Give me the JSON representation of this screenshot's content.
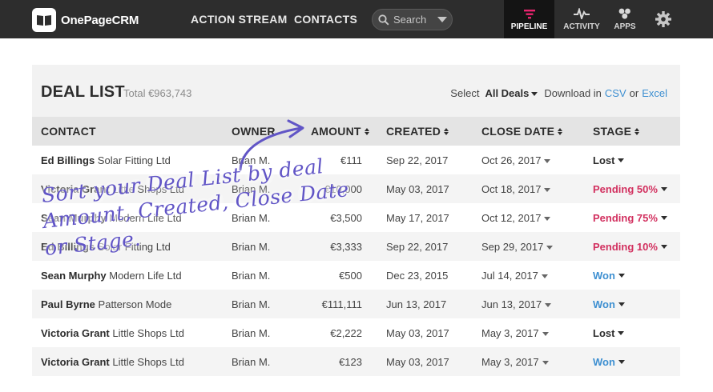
{
  "brand": {
    "name": "OnePageCRM"
  },
  "nav": {
    "links": [
      "ACTION STREAM",
      "CONTACTS"
    ],
    "search_placeholder": "Search",
    "icon_tabs": [
      {
        "label": "PIPELINE",
        "icon": "funnel-icon",
        "active": true
      },
      {
        "label": "ACTIVITY",
        "icon": "pulse-icon",
        "active": false
      },
      {
        "label": "APPS",
        "icon": "apps-icon",
        "active": false
      }
    ],
    "settings_icon": "gear-icon"
  },
  "deal_list": {
    "title": "DEAL LIST",
    "total": "Total €963,743",
    "select_label": "Select",
    "select_value": "All Deals",
    "download_label": "Download in",
    "csv_label": "CSV",
    "or_label": "or",
    "excel_label": "Excel",
    "columns": [
      "CONTACT",
      "OWNER",
      "AMOUNT",
      "CREATED",
      "CLOSE DATE",
      "STAGE"
    ],
    "rows": [
      {
        "name": "Ed Billings",
        "company": "Solar Fitting Ltd",
        "owner": "Brian M.",
        "amount": "€111",
        "created": "Sep 22, 2017",
        "close": "Oct 26, 2017",
        "stage": "Lost",
        "stage_color": "#2d2d2d"
      },
      {
        "name": "Victoria Grant",
        "company": "Little Shops Ltd",
        "owner": "Brian M.",
        "amount": "€10,000",
        "created": "May 03, 2017",
        "close": "Oct 18, 2017",
        "stage": "Pending 50%",
        "stage_color": "#d2305f"
      },
      {
        "name": "Sean Murphy",
        "company": "Modern Life Ltd",
        "owner": "Brian M.",
        "amount": "€3,500",
        "created": "May 17, 2017",
        "close": "Oct 12, 2017",
        "stage": "Pending 75%",
        "stage_color": "#d2305f"
      },
      {
        "name": "Ed Billings",
        "company": "Solar Fitting Ltd",
        "owner": "Brian M.",
        "amount": "€3,333",
        "created": "Sep 22, 2017",
        "close": "Sep 29, 2017",
        "stage": "Pending 10%",
        "stage_color": "#d2305f"
      },
      {
        "name": "Sean Murphy",
        "company": "Modern Life Ltd",
        "owner": "Brian M.",
        "amount": "€500",
        "created": "Dec 23, 2015",
        "close": "Jul 14, 2017",
        "stage": "Won",
        "stage_color": "#3d8fd1"
      },
      {
        "name": "Paul Byrne",
        "company": "Patterson Mode",
        "owner": "Brian M.",
        "amount": "€111,111",
        "created": "Jun 13, 2017",
        "close": "Jun 13, 2017",
        "stage": "Won",
        "stage_color": "#3d8fd1"
      },
      {
        "name": "Victoria Grant",
        "company": "Little Shops Ltd",
        "owner": "Brian M.",
        "amount": "€2,222",
        "created": "May 03, 2017",
        "close": "May 3, 2017",
        "stage": "Lost",
        "stage_color": "#2d2d2d"
      },
      {
        "name": "Victoria Grant",
        "company": "Little Shops Ltd",
        "owner": "Brian M.",
        "amount": "€123",
        "created": "May 03, 2017",
        "close": "May 3, 2017",
        "stage": "Won",
        "stage_color": "#3d8fd1"
      }
    ]
  },
  "annotation": {
    "lines": [
      "Sort your Deal List by deal",
      "Amount, Created, Close Date",
      "or Stage."
    ],
    "color": "#6155c6"
  },
  "colors": {
    "topbar": "#2d2d2d",
    "accent_pink": "#e8246e",
    "link_blue": "#3d8fd1"
  }
}
